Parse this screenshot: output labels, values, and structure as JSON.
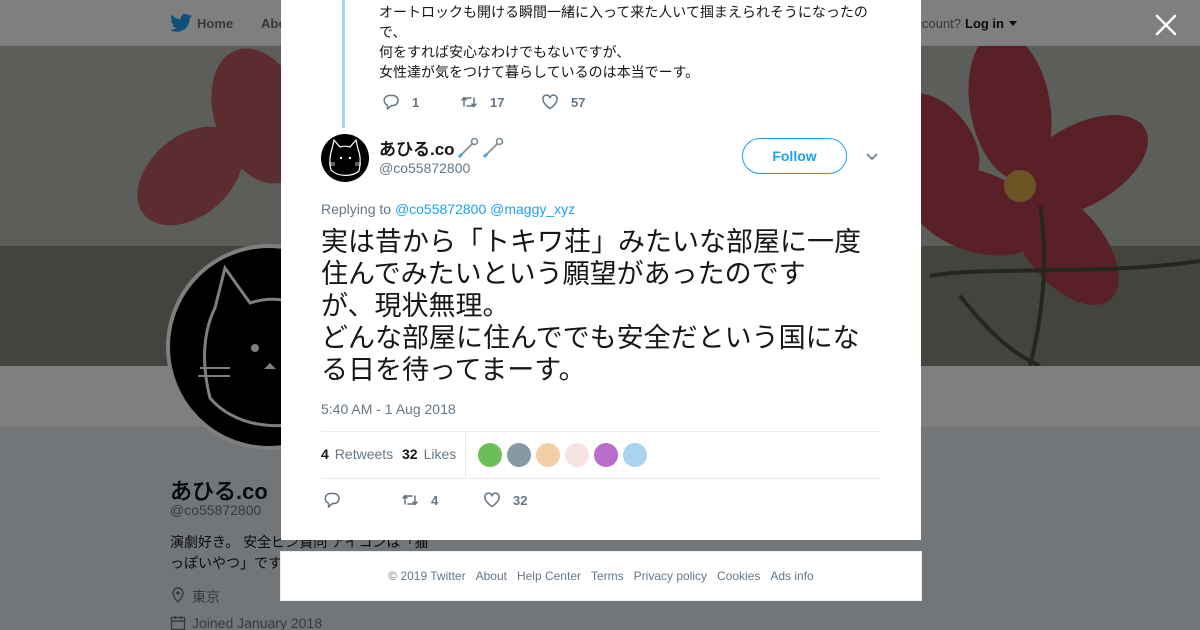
{
  "nav": {
    "home": "Home",
    "about": "Abo",
    "account_prompt": "ccount?",
    "login": "Log in"
  },
  "profile": {
    "name": "あひる.co",
    "handle": "@co55872800",
    "bio": "演劇好き。 安全ピン賛同 アイコンは「猫っぽいやつ」です",
    "location": "東京",
    "joined": "Joined January 2018"
  },
  "parent_tweet": {
    "lines": [
      "オートロックも開ける瞬間一緒に入って来た人いて掴まえられそうになったの",
      "で、",
      "何をすれば安心なわけでもないですが、",
      "女性達が気をつけて暮らしているのは本当でーす。"
    ],
    "replies": "1",
    "retweets": "17",
    "likes": "57"
  },
  "tweet": {
    "name": "あひる.co",
    "handle": "@co55872800",
    "follow": "Follow",
    "replying_prefix": "Replying to",
    "reply_to_1": "@co55872800",
    "reply_to_2": "@maggy_xyz",
    "lines": [
      "実は昔から「トキワ荘」みたいな部屋に一度",
      "住んでみたいという願望があったのです",
      "が、現状無理。",
      "どんな部屋に住んででも安全だという国にな",
      "る日を待ってまーす。"
    ],
    "timestamp": "5:40 AM - 1 Aug 2018",
    "retweets_count": "4",
    "retweets_label": "Retweets",
    "likes_count": "32",
    "likes_label": "Likes",
    "action_retweets": "4",
    "action_likes": "32"
  },
  "likers": [
    "#6bbf59",
    "#8899a6",
    "#f3cfa5",
    "#f7e4e0",
    "#b86ec9",
    "#a9d3ee"
  ],
  "footer": [
    "© 2019 Twitter",
    "About",
    "Help Center",
    "Terms",
    "Privacy policy",
    "Cookies",
    "Ads info"
  ],
  "colors": {
    "accent": "#1da1f2",
    "thread_line": "#a3d3f5",
    "text_secondary": "#657786"
  },
  "icons": [
    "twitter-bird-icon",
    "close-icon",
    "reply-icon",
    "retweet-icon",
    "heart-icon",
    "chevron-down-icon",
    "safety-pin-icon",
    "location-icon",
    "calendar-icon"
  ]
}
